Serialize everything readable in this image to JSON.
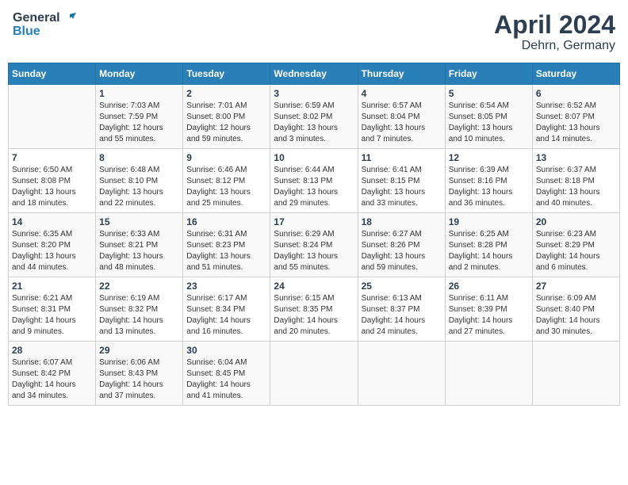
{
  "header": {
    "logo_line1": "General",
    "logo_line2": "Blue",
    "title": "April 2024",
    "subtitle": "Dehrn, Germany"
  },
  "days_of_week": [
    "Sunday",
    "Monday",
    "Tuesday",
    "Wednesday",
    "Thursday",
    "Friday",
    "Saturday"
  ],
  "weeks": [
    [
      {
        "day": "",
        "info": ""
      },
      {
        "day": "1",
        "info": "Sunrise: 7:03 AM\nSunset: 7:59 PM\nDaylight: 12 hours\nand 55 minutes."
      },
      {
        "day": "2",
        "info": "Sunrise: 7:01 AM\nSunset: 8:00 PM\nDaylight: 12 hours\nand 59 minutes."
      },
      {
        "day": "3",
        "info": "Sunrise: 6:59 AM\nSunset: 8:02 PM\nDaylight: 13 hours\nand 3 minutes."
      },
      {
        "day": "4",
        "info": "Sunrise: 6:57 AM\nSunset: 8:04 PM\nDaylight: 13 hours\nand 7 minutes."
      },
      {
        "day": "5",
        "info": "Sunrise: 6:54 AM\nSunset: 8:05 PM\nDaylight: 13 hours\nand 10 minutes."
      },
      {
        "day": "6",
        "info": "Sunrise: 6:52 AM\nSunset: 8:07 PM\nDaylight: 13 hours\nand 14 minutes."
      }
    ],
    [
      {
        "day": "7",
        "info": "Sunrise: 6:50 AM\nSunset: 8:08 PM\nDaylight: 13 hours\nand 18 minutes."
      },
      {
        "day": "8",
        "info": "Sunrise: 6:48 AM\nSunset: 8:10 PM\nDaylight: 13 hours\nand 22 minutes."
      },
      {
        "day": "9",
        "info": "Sunrise: 6:46 AM\nSunset: 8:12 PM\nDaylight: 13 hours\nand 25 minutes."
      },
      {
        "day": "10",
        "info": "Sunrise: 6:44 AM\nSunset: 8:13 PM\nDaylight: 13 hours\nand 29 minutes."
      },
      {
        "day": "11",
        "info": "Sunrise: 6:41 AM\nSunset: 8:15 PM\nDaylight: 13 hours\nand 33 minutes."
      },
      {
        "day": "12",
        "info": "Sunrise: 6:39 AM\nSunset: 8:16 PM\nDaylight: 13 hours\nand 36 minutes."
      },
      {
        "day": "13",
        "info": "Sunrise: 6:37 AM\nSunset: 8:18 PM\nDaylight: 13 hours\nand 40 minutes."
      }
    ],
    [
      {
        "day": "14",
        "info": "Sunrise: 6:35 AM\nSunset: 8:20 PM\nDaylight: 13 hours\nand 44 minutes."
      },
      {
        "day": "15",
        "info": "Sunrise: 6:33 AM\nSunset: 8:21 PM\nDaylight: 13 hours\nand 48 minutes."
      },
      {
        "day": "16",
        "info": "Sunrise: 6:31 AM\nSunset: 8:23 PM\nDaylight: 13 hours\nand 51 minutes."
      },
      {
        "day": "17",
        "info": "Sunrise: 6:29 AM\nSunset: 8:24 PM\nDaylight: 13 hours\nand 55 minutes."
      },
      {
        "day": "18",
        "info": "Sunrise: 6:27 AM\nSunset: 8:26 PM\nDaylight: 13 hours\nand 59 minutes."
      },
      {
        "day": "19",
        "info": "Sunrise: 6:25 AM\nSunset: 8:28 PM\nDaylight: 14 hours\nand 2 minutes."
      },
      {
        "day": "20",
        "info": "Sunrise: 6:23 AM\nSunset: 8:29 PM\nDaylight: 14 hours\nand 6 minutes."
      }
    ],
    [
      {
        "day": "21",
        "info": "Sunrise: 6:21 AM\nSunset: 8:31 PM\nDaylight: 14 hours\nand 9 minutes."
      },
      {
        "day": "22",
        "info": "Sunrise: 6:19 AM\nSunset: 8:32 PM\nDaylight: 14 hours\nand 13 minutes."
      },
      {
        "day": "23",
        "info": "Sunrise: 6:17 AM\nSunset: 8:34 PM\nDaylight: 14 hours\nand 16 minutes."
      },
      {
        "day": "24",
        "info": "Sunrise: 6:15 AM\nSunset: 8:35 PM\nDaylight: 14 hours\nand 20 minutes."
      },
      {
        "day": "25",
        "info": "Sunrise: 6:13 AM\nSunset: 8:37 PM\nDaylight: 14 hours\nand 24 minutes."
      },
      {
        "day": "26",
        "info": "Sunrise: 6:11 AM\nSunset: 8:39 PM\nDaylight: 14 hours\nand 27 minutes."
      },
      {
        "day": "27",
        "info": "Sunrise: 6:09 AM\nSunset: 8:40 PM\nDaylight: 14 hours\nand 30 minutes."
      }
    ],
    [
      {
        "day": "28",
        "info": "Sunrise: 6:07 AM\nSunset: 8:42 PM\nDaylight: 14 hours\nand 34 minutes."
      },
      {
        "day": "29",
        "info": "Sunrise: 6:06 AM\nSunset: 8:43 PM\nDaylight: 14 hours\nand 37 minutes."
      },
      {
        "day": "30",
        "info": "Sunrise: 6:04 AM\nSunset: 8:45 PM\nDaylight: 14 hours\nand 41 minutes."
      },
      {
        "day": "",
        "info": ""
      },
      {
        "day": "",
        "info": ""
      },
      {
        "day": "",
        "info": ""
      },
      {
        "day": "",
        "info": ""
      }
    ]
  ]
}
